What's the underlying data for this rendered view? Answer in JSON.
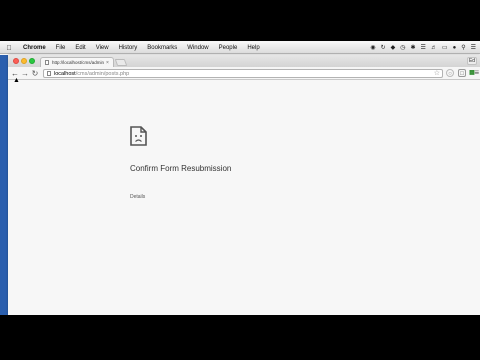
{
  "menubar": {
    "app_name": "Chrome",
    "items": [
      "File",
      "Edit",
      "View",
      "History",
      "Bookmarks",
      "Window",
      "People",
      "Help"
    ]
  },
  "browser": {
    "tab_title": "http://localhost/cms/admin/",
    "profile": "Ed",
    "url_host": "localhost",
    "url_path": "/cms/admin/posts.php"
  },
  "page": {
    "heading": "Confirm Form Resubmission",
    "details_link": "Details"
  },
  "colors": {
    "desktop_edge": "#2b5fae",
    "page_background": "#f7f7f7"
  }
}
